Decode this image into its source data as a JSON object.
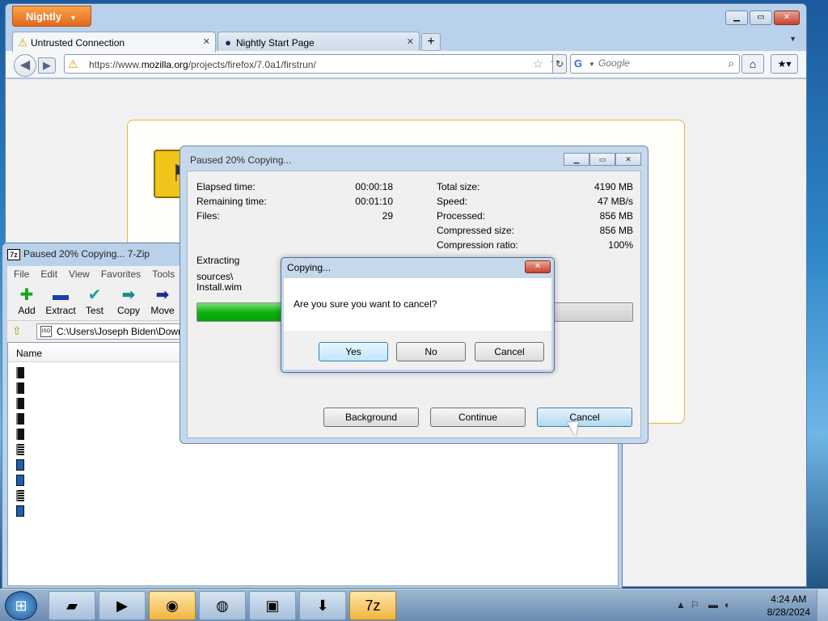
{
  "browser": {
    "app_button": "Nightly",
    "tabs": [
      {
        "label": "Untrusted Connection"
      },
      {
        "label": "Nightly Start Page"
      }
    ],
    "url_prefix": "https://www.",
    "url_domain": "mozilla.org",
    "url_path": "/projects/firefox/7.0a1/firstrun/",
    "search_placeholder": "Google"
  },
  "zip_manager": {
    "title": "Paused 20% Copying... 7-Zip",
    "menu": [
      "File",
      "Edit",
      "View",
      "Favorites",
      "Tools"
    ],
    "toolbar": [
      "Add",
      "Extract",
      "Test",
      "Copy",
      "Move"
    ],
    "path": "C:\\Users\\Joseph Biden\\Down",
    "column_name": "Name",
    "file_icon_types": [
      "dark",
      "dark",
      "dark",
      "dark",
      "dark",
      "lines",
      "blue",
      "blue",
      "lines",
      "blue"
    ]
  },
  "copy_window": {
    "title": "Paused 20% Copying...",
    "left_stats": [
      {
        "label": "Elapsed time:",
        "value": "00:00:18"
      },
      {
        "label": "Remaining time:",
        "value": "00:01:10"
      },
      {
        "label": "Files:",
        "value": "29"
      }
    ],
    "right_stats": [
      {
        "label": "Total size:",
        "value": "4190 MB"
      },
      {
        "label": "Speed:",
        "value": "47 MB/s"
      },
      {
        "label": "Processed:",
        "value": "856 MB"
      },
      {
        "label": "Compressed size:",
        "value": "856 MB"
      },
      {
        "label": "Compression ratio:",
        "value": "100%"
      }
    ],
    "operation": "Extracting",
    "current_path": "sources\\",
    "current_file": "Install.wim",
    "progress_fraction": 0.2,
    "buttons": {
      "background": "Background",
      "continue": "Continue",
      "cancel": "Cancel"
    }
  },
  "confirm_dialog": {
    "title": "Copying...",
    "message": "Are you sure you want to cancel?",
    "yes": "Yes",
    "no": "No",
    "cancel": "Cancel"
  },
  "taskbar": {
    "time": "4:24 AM",
    "date": "8/28/2024",
    "apps": [
      "terminal",
      "media-player",
      "nightly",
      "firefox",
      "virtualbox",
      "download-manager",
      "7zip"
    ]
  },
  "colors": {
    "progress_green": "#0fb30f",
    "nightly_orange": "#e2691c"
  }
}
